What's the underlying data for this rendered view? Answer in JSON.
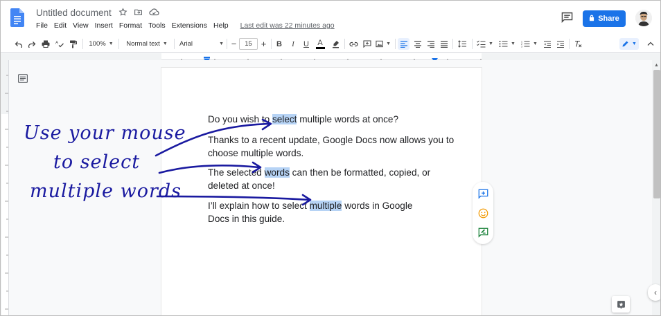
{
  "header": {
    "title": "Untitled document",
    "menu": [
      "File",
      "Edit",
      "View",
      "Insert",
      "Format",
      "Tools",
      "Extensions",
      "Help"
    ],
    "last_edit": "Last edit was 22 minutes ago",
    "share_label": "Share"
  },
  "toolbar": {
    "zoom": "100%",
    "style": "Normal text",
    "font": "Arial",
    "font_size": "15"
  },
  "document": {
    "paragraphs": [
      {
        "before": "Do you wish to ",
        "highlight": "select",
        "after": " multiple words at once?"
      },
      {
        "before": "Thanks to a recent update, Google Docs now allows you to choose multiple words.",
        "highlight": "",
        "after": ""
      },
      {
        "before": "The selected ",
        "highlight": "words",
        "after": " can then be formatted, copied, or deleted at once!"
      },
      {
        "before": "I’ll explain how to select ",
        "highlight": "multiple",
        "after": " words in Google Docs in this guide."
      }
    ]
  },
  "annotation": {
    "lines": [
      "Use your mouse",
      "to select",
      "multiple words"
    ],
    "color": "#1a1aa0"
  },
  "colors": {
    "accent": "#1a73e8",
    "highlight": "#b6d3f5"
  },
  "icons": {
    "side": [
      "add-comment-icon",
      "emoji-reaction-icon",
      "suggest-edits-icon"
    ]
  }
}
